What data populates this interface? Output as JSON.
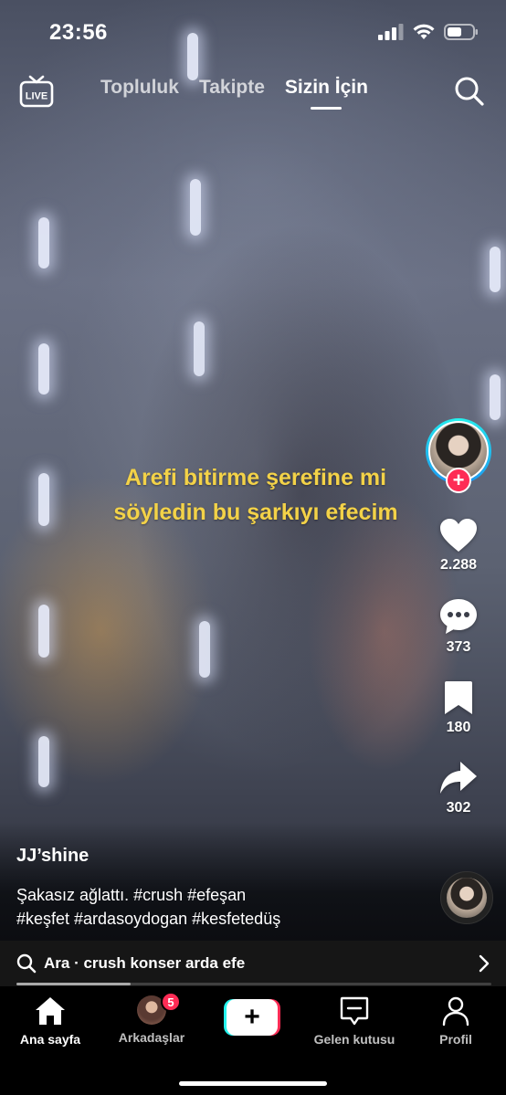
{
  "status_bar": {
    "time": "23:56"
  },
  "top_nav": {
    "live_label": "LIVE",
    "tabs": [
      {
        "label": "Topluluk"
      },
      {
        "label": "Takipte"
      },
      {
        "label": "Sizin İçin"
      }
    ]
  },
  "video": {
    "caption_line1": "Arefi bitirme şerefine mi",
    "caption_line2": "söyledin bu şarkıyı efecim",
    "caption_color": "#f3d248"
  },
  "side_rail": {
    "follow_symbol": "+",
    "likes": "2.288",
    "comments": "373",
    "saves": "180",
    "shares": "302"
  },
  "post": {
    "username": "JJ’shine",
    "description_line1": "Şakasız ağlattı. #crush #efeşan",
    "description_line2": "#keşfet #ardasoydogan #kesfetedüş"
  },
  "search_banner": {
    "text": "Ara · crush konser arda efe"
  },
  "playback": {
    "progress": 0.24
  },
  "bottom_nav": {
    "home": "Ana sayfa",
    "friends": "Arkadaşlar",
    "friends_badge": "5",
    "create_symbol": "+",
    "inbox": "Gelen kutusu",
    "profile": "Profil"
  },
  "colors": {
    "accent_red": "#fe2c55",
    "accent_cyan": "#25f4ee"
  }
}
